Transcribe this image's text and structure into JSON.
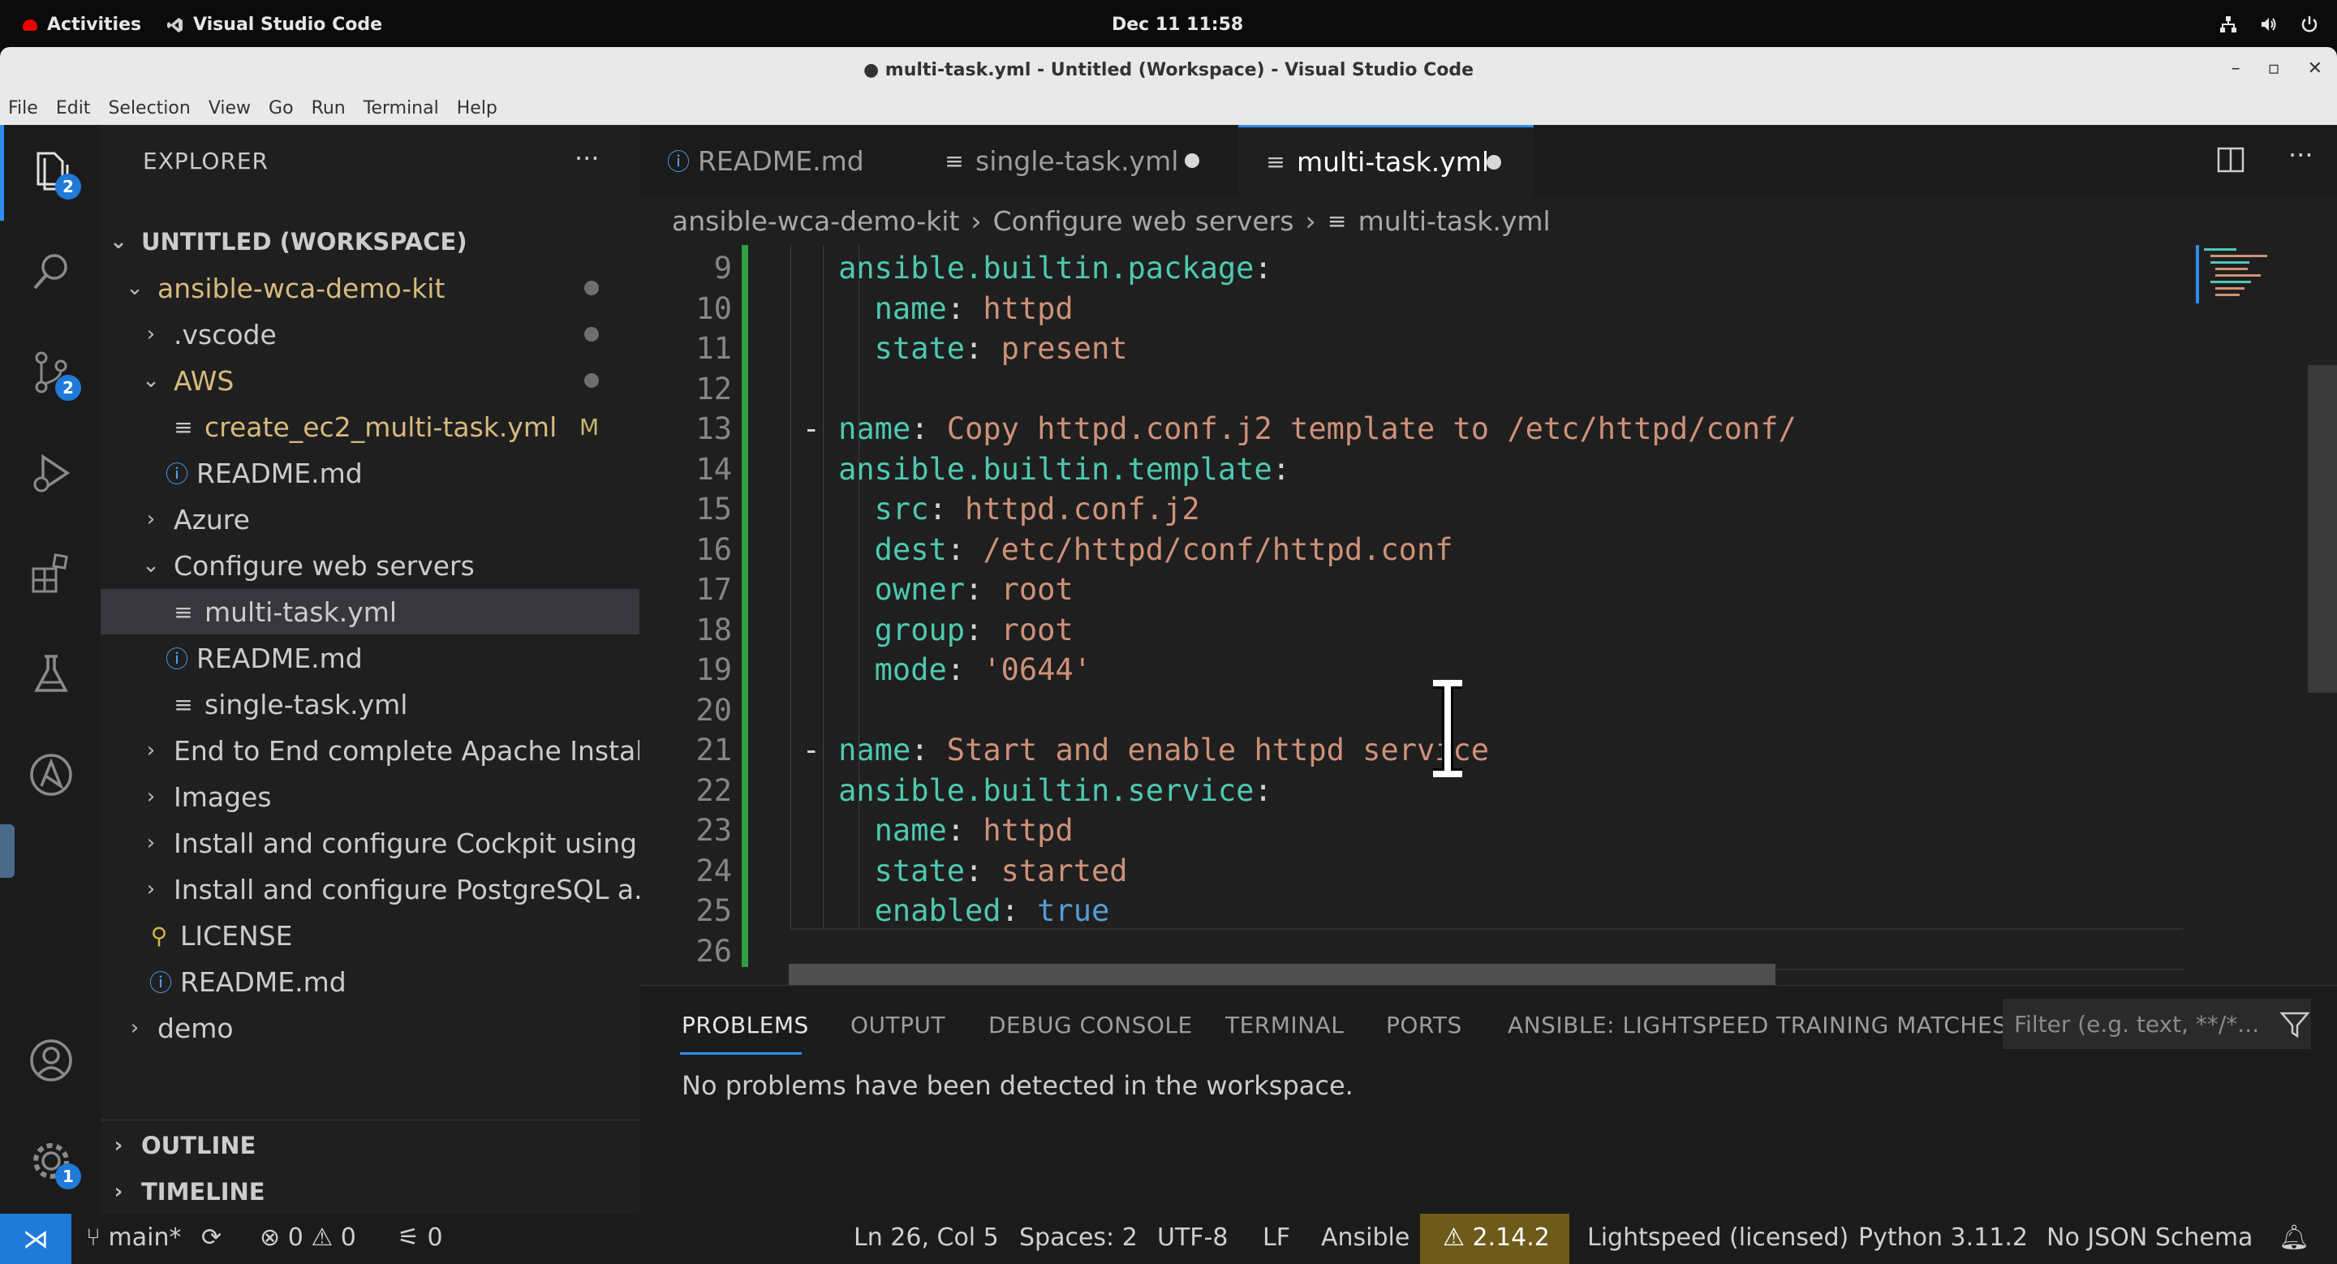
{
  "topbar": {
    "activities": "Activities",
    "app_name": "Visual Studio Code",
    "clock": "Dec 11  11:58"
  },
  "window": {
    "title": "● multi-task.yml - Untitled (Workspace) - Visual Studio Code"
  },
  "menu": [
    "File",
    "Edit",
    "Selection",
    "View",
    "Go",
    "Run",
    "Terminal",
    "Help"
  ],
  "activity_bar": {
    "explorer_badge": "2",
    "scm_badge": "2",
    "settings_badge": "1"
  },
  "explorer": {
    "header": "EXPLORER",
    "more": "···",
    "tree": [
      {
        "label": "UNTITLED (WORKSPACE)",
        "chevron": "open"
      },
      {
        "label": "ansible-wca-demo-kit",
        "chevron": "open",
        "indicator": "dot"
      },
      {
        "label": ".vscode",
        "chevron": "closed",
        "indicator": "dot"
      },
      {
        "label": "AWS",
        "chevron": "open",
        "indicator": "dot"
      },
      {
        "label": "create_ec2_multi-task.yml",
        "icon": "file",
        "indicator": "M"
      },
      {
        "label": "README.md",
        "icon": "info"
      },
      {
        "label": "Azure",
        "chevron": "closed"
      },
      {
        "label": "Configure web servers",
        "chevron": "open"
      },
      {
        "label": "multi-task.yml",
        "icon": "file",
        "selected": true
      },
      {
        "label": "README.md",
        "icon": "info"
      },
      {
        "label": "single-task.yml",
        "icon": "file"
      },
      {
        "label": "End to End complete Apache Install",
        "chevron": "closed"
      },
      {
        "label": "Images",
        "chevron": "closed"
      },
      {
        "label": "Install and configure Cockpit using...",
        "chevron": "closed"
      },
      {
        "label": "Install and configure PostgreSQL a...",
        "chevron": "closed"
      },
      {
        "label": "LICENSE",
        "icon": "license"
      },
      {
        "label": "README.md",
        "icon": "info"
      },
      {
        "label": "demo",
        "chevron": "closed"
      }
    ],
    "outline": "OUTLINE",
    "timeline": "TIMELINE"
  },
  "tabs": [
    {
      "label": "README.md",
      "icon": "info"
    },
    {
      "label": "single-task.yml",
      "icon": "file",
      "modified": true
    },
    {
      "label": "multi-task.yml",
      "icon": "file",
      "modified": true,
      "active": true
    }
  ],
  "breadcrumb": [
    "ansible-wca-demo-kit",
    "Configure web servers",
    "multi-task.yml"
  ],
  "editor": {
    "lines": [
      {
        "n": "9",
        "indent": "    ",
        "parts": [
          {
            "t": "ansible.builtin.package",
            "c": "key"
          },
          {
            "t": ":",
            "c": "pun"
          }
        ]
      },
      {
        "n": "10",
        "indent": "      ",
        "parts": [
          {
            "t": "name",
            "c": "key"
          },
          {
            "t": ": ",
            "c": "pun"
          },
          {
            "t": "httpd",
            "c": "str"
          }
        ]
      },
      {
        "n": "11",
        "indent": "      ",
        "parts": [
          {
            "t": "state",
            "c": "key"
          },
          {
            "t": ": ",
            "c": "pun"
          },
          {
            "t": "present",
            "c": "str"
          }
        ]
      },
      {
        "n": "12",
        "indent": "",
        "parts": []
      },
      {
        "n": "13",
        "indent": "  ",
        "parts": [
          {
            "t": "- ",
            "c": "dash"
          },
          {
            "t": "name",
            "c": "key"
          },
          {
            "t": ": ",
            "c": "pun"
          },
          {
            "t": "Copy httpd.conf.j2 template to /etc/httpd/conf/",
            "c": "str"
          }
        ]
      },
      {
        "n": "14",
        "indent": "    ",
        "parts": [
          {
            "t": "ansible.builtin.template",
            "c": "key"
          },
          {
            "t": ":",
            "c": "pun"
          }
        ]
      },
      {
        "n": "15",
        "indent": "      ",
        "parts": [
          {
            "t": "src",
            "c": "key"
          },
          {
            "t": ": ",
            "c": "pun"
          },
          {
            "t": "httpd.conf.j2",
            "c": "str"
          }
        ]
      },
      {
        "n": "16",
        "indent": "      ",
        "parts": [
          {
            "t": "dest",
            "c": "key"
          },
          {
            "t": ": ",
            "c": "pun"
          },
          {
            "t": "/etc/httpd/conf/httpd.conf",
            "c": "str"
          }
        ]
      },
      {
        "n": "17",
        "indent": "      ",
        "parts": [
          {
            "t": "owner",
            "c": "key"
          },
          {
            "t": ": ",
            "c": "pun"
          },
          {
            "t": "root",
            "c": "str"
          }
        ]
      },
      {
        "n": "18",
        "indent": "      ",
        "parts": [
          {
            "t": "group",
            "c": "key"
          },
          {
            "t": ": ",
            "c": "pun"
          },
          {
            "t": "root",
            "c": "str"
          }
        ]
      },
      {
        "n": "19",
        "indent": "      ",
        "parts": [
          {
            "t": "mode",
            "c": "key"
          },
          {
            "t": ": ",
            "c": "pun"
          },
          {
            "t": "'0644'",
            "c": "str"
          }
        ]
      },
      {
        "n": "20",
        "indent": "",
        "parts": []
      },
      {
        "n": "21",
        "indent": "  ",
        "parts": [
          {
            "t": "- ",
            "c": "dash"
          },
          {
            "t": "name",
            "c": "key"
          },
          {
            "t": ": ",
            "c": "pun"
          },
          {
            "t": "Start and enable httpd service",
            "c": "str"
          }
        ]
      },
      {
        "n": "22",
        "indent": "    ",
        "parts": [
          {
            "t": "ansible.builtin.service",
            "c": "key"
          },
          {
            "t": ":",
            "c": "pun"
          }
        ]
      },
      {
        "n": "23",
        "indent": "      ",
        "parts": [
          {
            "t": "name",
            "c": "key"
          },
          {
            "t": ": ",
            "c": "pun"
          },
          {
            "t": "httpd",
            "c": "str"
          }
        ]
      },
      {
        "n": "24",
        "indent": "      ",
        "parts": [
          {
            "t": "state",
            "c": "key"
          },
          {
            "t": ": ",
            "c": "pun"
          },
          {
            "t": "started",
            "c": "str"
          }
        ]
      },
      {
        "n": "25",
        "indent": "      ",
        "parts": [
          {
            "t": "enabled",
            "c": "key"
          },
          {
            "t": ": ",
            "c": "pun"
          },
          {
            "t": "true",
            "c": "kw"
          }
        ]
      },
      {
        "n": "26",
        "indent": "",
        "parts": []
      }
    ]
  },
  "panel": {
    "tabs": [
      "PROBLEMS",
      "OUTPUT",
      "DEBUG CONSOLE",
      "TERMINAL",
      "PORTS",
      "ANSIBLE: LIGHTSPEED TRAINING MATCHES"
    ],
    "active_tab": "PROBLEMS",
    "filter_placeholder": "Filter (e.g. text, **/*...",
    "message": "No problems have been detected in the workspace."
  },
  "status": {
    "branch": "main*",
    "errors": "0",
    "warnings": "0",
    "ports": "0",
    "position": "Ln 26, Col 5",
    "spaces": "Spaces: 2",
    "encoding": "UTF-8",
    "eol": "LF",
    "language": "Ansible",
    "ansible_version": "2.14.2",
    "lightspeed": "Lightspeed (licensed)",
    "python": "Python 3.11.2",
    "json_schema": "No JSON Schema"
  },
  "colors": {
    "accent": "#2e8ef0",
    "key": "#4ec9b0",
    "string": "#ce9178",
    "keyword": "#569cd6",
    "git_added": "#2ea043",
    "warning_bg": "#6e5b1a"
  }
}
